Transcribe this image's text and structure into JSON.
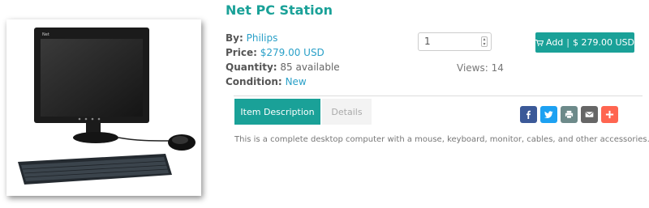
{
  "product": {
    "title": "Net PC Station",
    "by_label": "By:",
    "brand": "Philips",
    "price_label": "Price:",
    "price": "$279.00 USD",
    "quantity_label": "Quantity:",
    "quantity": "85 available",
    "condition_label": "Condition:",
    "condition": "New",
    "image_brand": "Net"
  },
  "cart": {
    "quantity_value": "1",
    "add_label": "Add",
    "add_separator": "|",
    "add_price": "$ 279.00 USD",
    "cart_icon": "shopping-cart-icon"
  },
  "stats": {
    "views": "Views: 14"
  },
  "tabs": [
    {
      "label": "Item Description",
      "active": true
    },
    {
      "label": "Details",
      "active": false
    }
  ],
  "share": [
    {
      "icon": "facebook-icon",
      "color": "#3b5998"
    },
    {
      "icon": "twitter-icon",
      "color": "#1da1f2"
    },
    {
      "icon": "print-icon",
      "color": "#6d8a8a"
    },
    {
      "icon": "email-icon",
      "color": "#666666"
    },
    {
      "icon": "plus-icon",
      "color": "#ff6550"
    }
  ],
  "description": "This is a complete desktop computer with a mouse, keyboard, monitor, cables, and other accessories.",
  "colors": {
    "accent": "#1aa198",
    "link": "#2aa0c8"
  }
}
